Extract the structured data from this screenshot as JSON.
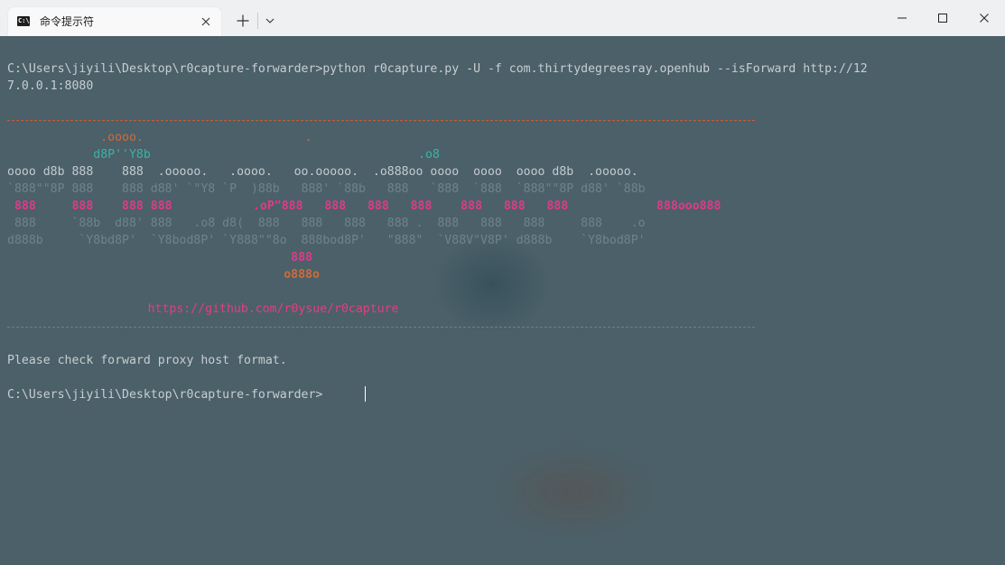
{
  "window": {
    "tab_title": "命令提示符",
    "tab_icon": "console-icon",
    "tab_icon_glyph": "C:\\",
    "new_tab_icon": "plus-icon",
    "dropdown_icon": "chevron-down-icon",
    "minimize_icon": "minimize-icon",
    "maximize_icon": "maximize-icon",
    "close_icon": "close-icon"
  },
  "colors": {
    "terminal_bg": "#4b6069",
    "text": "#c8ced1",
    "banner_orange": "#d06a3a",
    "banner_teal": "#3bb3a5",
    "banner_pink": "#e03a87",
    "banner_dim": "#6f838b"
  },
  "terminal": {
    "command_line_1": "C:\\Users\\jiyili\\Desktop\\r0capture-forwarder>python r0capture.py -U -f com.thirtydegreesray.openhub --isForward http://12",
    "command_line_2": "7.0.0.1:8080",
    "banner": {
      "l1_a": "             .oooo.",
      "l1_b": "                                       .",
      "l2_a": "            d8P''Y8b",
      "l2_b": "                                .o8",
      "l3": "oooo d8b 888    888  .ooooo.   .oooo.   oo.ooooo.  .o888oo oooo  oooo  oooo d8b  .ooooo.",
      "l4": "`888\"\"8P 888    888 d88' `\"Y8 `P  )88b   888' `88b   888   `888  `888  `888\"\"8P d88' `88b",
      "l5_a": " 888     888    888 888       ",
      "l5_b": " .oP\"888   888   888   888    888   888   888     ",
      "l5_c": "888ooo888",
      "l6": " 888     `88b  d88' 888   .o8 d8(  888   888   888   888 .  888   888   888     888    .o",
      "l7": "d888b     `Y8bd8P'  `Y8bod8P' `Y888\"\"8o  888bod8P'   \"888\"  `V88V\"V8P' d888b    `Y8bod8P'",
      "l8": "                                               888",
      "l9": "                                              o888o",
      "url": "                       https://github.com/r0ysue/r0capture"
    },
    "message": "Please check forward proxy host format.",
    "prompt": "C:\\Users\\jiyili\\Desktop\\r0capture-forwarder>"
  }
}
